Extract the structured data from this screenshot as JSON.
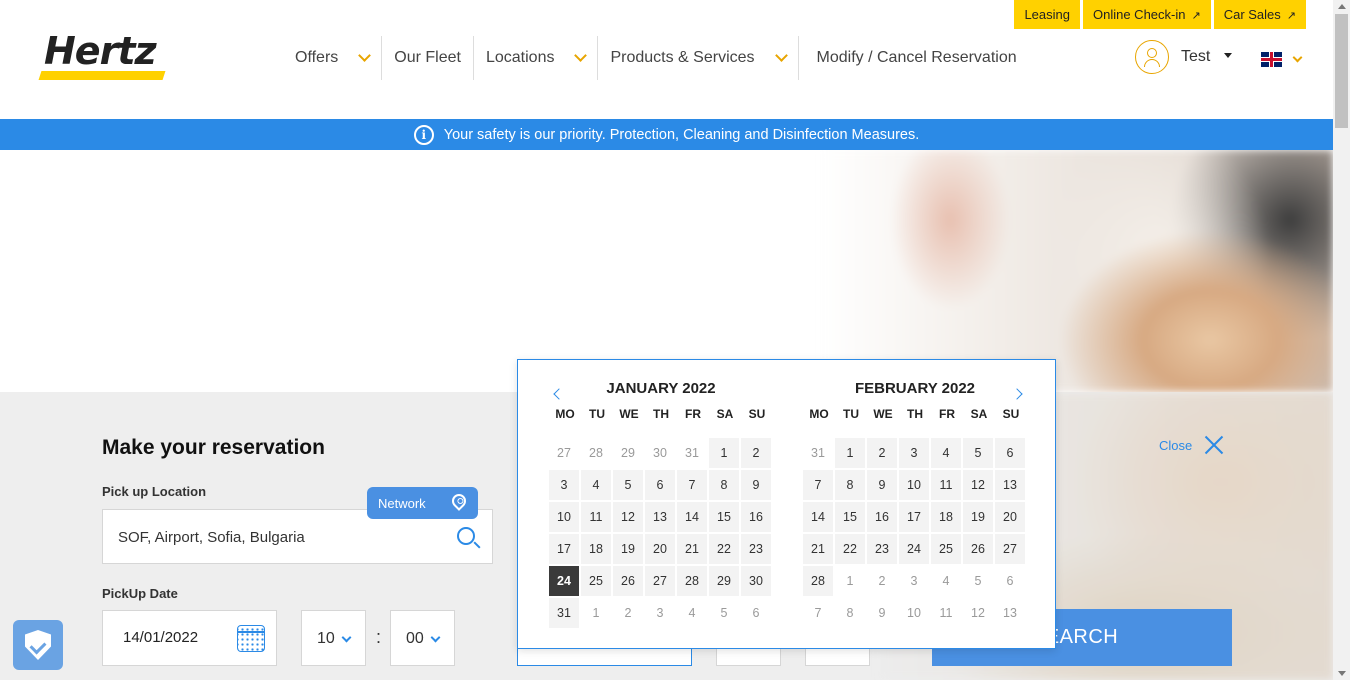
{
  "util_links": [
    {
      "label": "Leasing",
      "external": false
    },
    {
      "label": "Online Check-in",
      "external": true
    },
    {
      "label": "Car Sales",
      "external": true
    }
  ],
  "brand": {
    "logo_text": "Hertz",
    "accent": "#ffd100",
    "blue": "#2b8ae6"
  },
  "nav": [
    {
      "label": "Offers",
      "dropdown": true
    },
    {
      "label": "Our Fleet",
      "dropdown": false
    },
    {
      "label": "Locations",
      "dropdown": true
    },
    {
      "label": "Products & Services",
      "dropdown": true
    },
    {
      "label": "Modify / Cancel Reservation",
      "dropdown": false
    }
  ],
  "user": {
    "name": "Test"
  },
  "language": {
    "flag": "uk-flag-icon"
  },
  "banner": {
    "icon": "info-icon",
    "text": "Your safety is our priority. Protection, Cleaning and Disinfection Measures."
  },
  "reservation": {
    "title": "Make your reservation",
    "pickup_location_label": "Pick up Location",
    "pickup_location_value": "SOF, Airport, Sofia, Bulgaria",
    "network_label": "Network",
    "pickup_date_label": "PickUp Date",
    "pickup_date_value": "14/01/2022",
    "pickup_hour": "10",
    "pickup_minute": "00",
    "time_separator": ":",
    "search_label": "EARCH",
    "close_label": "Close"
  },
  "datepicker": {
    "weekdays": [
      "MO",
      "TU",
      "WE",
      "TH",
      "FR",
      "SA",
      "SU"
    ],
    "months": [
      {
        "title": "JANUARY 2022",
        "weeks": [
          [
            {
              "d": "27",
              "o": true
            },
            {
              "d": "28",
              "o": true
            },
            {
              "d": "29",
              "o": true
            },
            {
              "d": "30",
              "o": true
            },
            {
              "d": "31",
              "o": true
            },
            {
              "d": "1"
            },
            {
              "d": "2"
            }
          ],
          [
            {
              "d": "3"
            },
            {
              "d": "4"
            },
            {
              "d": "5"
            },
            {
              "d": "6"
            },
            {
              "d": "7"
            },
            {
              "d": "8"
            },
            {
              "d": "9"
            }
          ],
          [
            {
              "d": "10"
            },
            {
              "d": "11"
            },
            {
              "d": "12"
            },
            {
              "d": "13"
            },
            {
              "d": "14"
            },
            {
              "d": "15"
            },
            {
              "d": "16"
            }
          ],
          [
            {
              "d": "17"
            },
            {
              "d": "18"
            },
            {
              "d": "19"
            },
            {
              "d": "20"
            },
            {
              "d": "21"
            },
            {
              "d": "22"
            },
            {
              "d": "23"
            }
          ],
          [
            {
              "d": "24",
              "s": true
            },
            {
              "d": "25"
            },
            {
              "d": "26"
            },
            {
              "d": "27"
            },
            {
              "d": "28"
            },
            {
              "d": "29"
            },
            {
              "d": "30"
            }
          ],
          [
            {
              "d": "31"
            },
            {
              "d": "1",
              "o": true
            },
            {
              "d": "2",
              "o": true
            },
            {
              "d": "3",
              "o": true
            },
            {
              "d": "4",
              "o": true
            },
            {
              "d": "5",
              "o": true
            },
            {
              "d": "6",
              "o": true
            }
          ]
        ]
      },
      {
        "title": "FEBRUARY 2022",
        "weeks": [
          [
            {
              "d": "31",
              "o": true
            },
            {
              "d": "1"
            },
            {
              "d": "2"
            },
            {
              "d": "3"
            },
            {
              "d": "4"
            },
            {
              "d": "5"
            },
            {
              "d": "6"
            }
          ],
          [
            {
              "d": "7"
            },
            {
              "d": "8"
            },
            {
              "d": "9"
            },
            {
              "d": "10"
            },
            {
              "d": "11"
            },
            {
              "d": "12"
            },
            {
              "d": "13"
            }
          ],
          [
            {
              "d": "14"
            },
            {
              "d": "15"
            },
            {
              "d": "16"
            },
            {
              "d": "17"
            },
            {
              "d": "18"
            },
            {
              "d": "19"
            },
            {
              "d": "20"
            }
          ],
          [
            {
              "d": "21"
            },
            {
              "d": "22"
            },
            {
              "d": "23"
            },
            {
              "d": "24"
            },
            {
              "d": "25"
            },
            {
              "d": "26"
            },
            {
              "d": "27"
            }
          ],
          [
            {
              "d": "28"
            },
            {
              "d": "1",
              "o": true
            },
            {
              "d": "2",
              "o": true
            },
            {
              "d": "3",
              "o": true
            },
            {
              "d": "4",
              "o": true
            },
            {
              "d": "5",
              "o": true
            },
            {
              "d": "6",
              "o": true
            }
          ],
          [
            {
              "d": "7",
              "o": true
            },
            {
              "d": "8",
              "o": true
            },
            {
              "d": "9",
              "o": true
            },
            {
              "d": "10",
              "o": true
            },
            {
              "d": "11",
              "o": true
            },
            {
              "d": "12",
              "o": true
            },
            {
              "d": "13",
              "o": true
            }
          ]
        ]
      }
    ]
  }
}
